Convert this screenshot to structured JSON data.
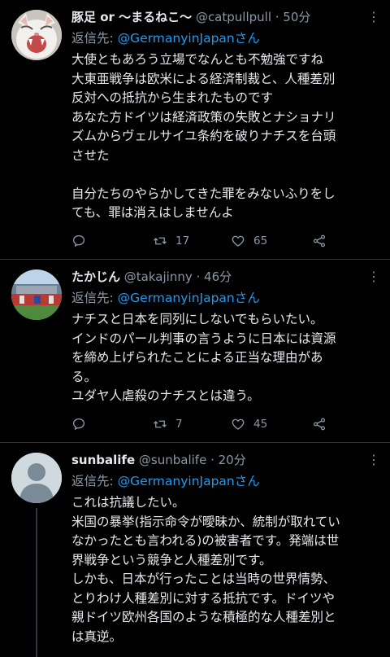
{
  "tweets": [
    {
      "name": "豚足 or 〜まるねこ〜",
      "handle": "@catpullpull",
      "time": "· 50分",
      "reply_prefix": "返信先: ",
      "reply_to": "@GermanyinJapan",
      "reply_suffix": "さん",
      "body": "大使ともあろう立場でなんとも不勉強ですね\n大東亜戦争は欧米による経済制裁と、人種差別\n反対への抵抗から生まれたものです\nあなた方ドイツは経済政策の失敗とナショナリ\nズムからヴェルサイユ条約を破りナチスを台頭\nさせた\n\n自分たちのやらかしてきた罪をみないふりをし\nても、罪は消えはしませんよ",
      "retweets": "17",
      "likes": "65",
      "avatar_icon": "cat-avatar-icon"
    },
    {
      "name": "たかじん",
      "handle": "@takajinny",
      "time": "· 46分",
      "reply_prefix": "返信先: ",
      "reply_to": "@GermanyinJapan",
      "reply_suffix": "さん",
      "body": "ナチスと日本を同列にしないでもらいたい。\nインドのパール判事の言うように日本には資源\nを締め上げられたことによる正当な理由があ\nる。\nユダヤ人虐殺のナチスとは違う。",
      "retweets": "7",
      "likes": "45",
      "avatar_icon": "stadium-avatar-icon"
    },
    {
      "name": "sunbalife",
      "handle": "@sunbalife",
      "time": "· 20分",
      "reply_prefix": "返信先: ",
      "reply_to": "@GermanyinJapan",
      "reply_suffix": "さん",
      "body": "これは抗議したい。\n米国の暴挙(指示命令が曖昧か、統制が取れてい\nなかったとも言われる)の被害者です。発端は世\n界戦争という競争と人種差別です。\nしかも、日本が行ったことは当時の世界情勢、\nとりわけ人種差別に対する抵抗です。ドイツや\n親ドイツ欧州各国のような積極的な人種差別と\nは真逆。",
      "avatar_icon": "default-profile-icon"
    }
  ],
  "colors": {
    "background": "#000000",
    "text": "#e7e9ea",
    "secondary": "#8b98a5",
    "accent": "#1d9bf0",
    "divider": "#2f3336"
  }
}
